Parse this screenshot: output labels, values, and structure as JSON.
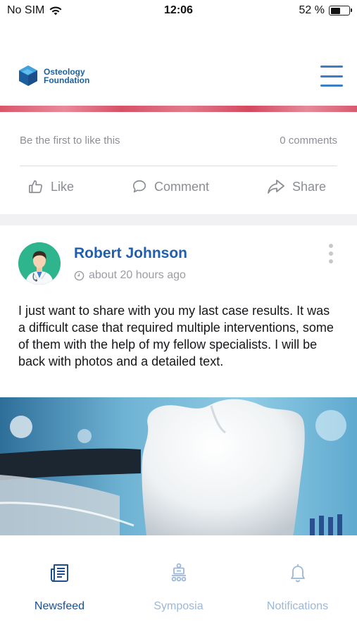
{
  "status_bar": {
    "carrier": "No SIM",
    "time": "12:06",
    "battery": "52 %",
    "battery_level": 0.52
  },
  "header": {
    "logo_line1": "Osteology",
    "logo_line2": "Foundation",
    "colors": {
      "brand": "#1c5f9e",
      "accent_strip": "#d9576b"
    }
  },
  "previous_post": {
    "likes_text": "Be the first to like this",
    "comments_text": "0 comments",
    "actions": {
      "like": "Like",
      "comment": "Comment",
      "share": "Share"
    }
  },
  "post": {
    "author": "Robert Johnson",
    "timestamp": "about 20 hours ago",
    "text": "I just want to share with you my last case results. It was a difficult case that required multiple interventions, some of them with the help of my fellow specialists. I will be back with photos and a detailed text.",
    "image_subject": "molar-tooth-photo"
  },
  "tab_bar": {
    "tabs": [
      {
        "label": "Newsfeed",
        "icon": "newspaper-icon",
        "active": true
      },
      {
        "label": "Symposia",
        "icon": "conference-icon",
        "active": false
      },
      {
        "label": "Notifications",
        "icon": "bell-icon",
        "active": false
      }
    ],
    "colors": {
      "active": "#1d4f8e",
      "inactive": "#9db7d8"
    }
  }
}
